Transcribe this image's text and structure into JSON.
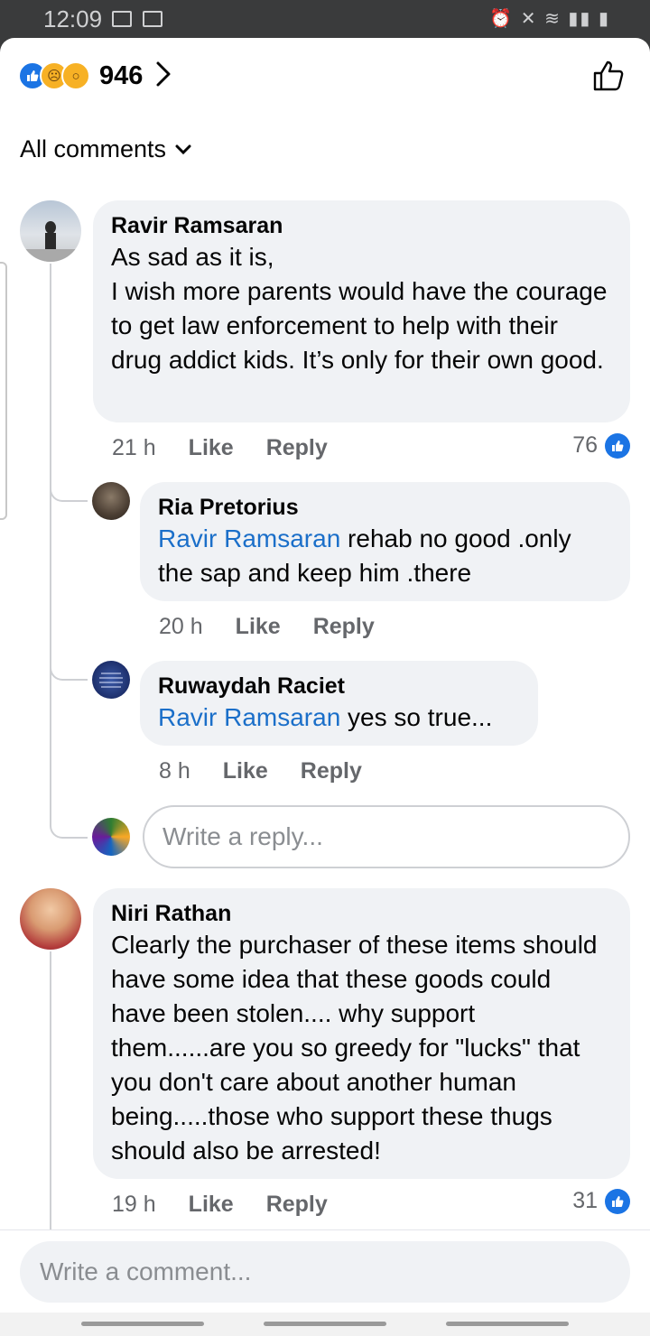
{
  "status_bar": {
    "time": "12:09"
  },
  "header": {
    "reaction_count": "946"
  },
  "filter": {
    "label": "All comments"
  },
  "comments": [
    {
      "author": "Ravir Ramsaran",
      "text": "As sad as it is,\nI wish more parents would have the courage to get law enforcement to help with their drug addict kids. It’s only for their own good.",
      "time": "21 h",
      "like_label": "Like",
      "reply_label": "Reply",
      "likes": "76",
      "replies": [
        {
          "author": "Ria Pretorius",
          "mention": "Ravir Ramsaran",
          "text": " rehab no good .only the sap and keep him .there",
          "time": "20 h",
          "like_label": "Like",
          "reply_label": "Reply"
        },
        {
          "author": "Ruwaydah Raciet",
          "mention": "Ravir Ramsaran",
          "text": " yes so true...",
          "time": "8 h",
          "like_label": "Like",
          "reply_label": "Reply"
        }
      ],
      "reply_placeholder": "Write a reply..."
    },
    {
      "author": "Niri Rathan",
      "text": "Clearly the purchaser of these items should have some idea that these goods could have been stolen.... why support them......are you so greedy for \"lucks\" that you don't care about another human being.....those who support these thugs should also be arrested!",
      "time": "19 h",
      "like_label": "Like",
      "reply_label": "Reply",
      "likes": "31"
    }
  ],
  "composer": {
    "placeholder": "Write a comment..."
  },
  "colors": {
    "link_blue": "#1b6fc9",
    "like_blue": "#1b74e4",
    "bubble": "#f0f2f5"
  }
}
